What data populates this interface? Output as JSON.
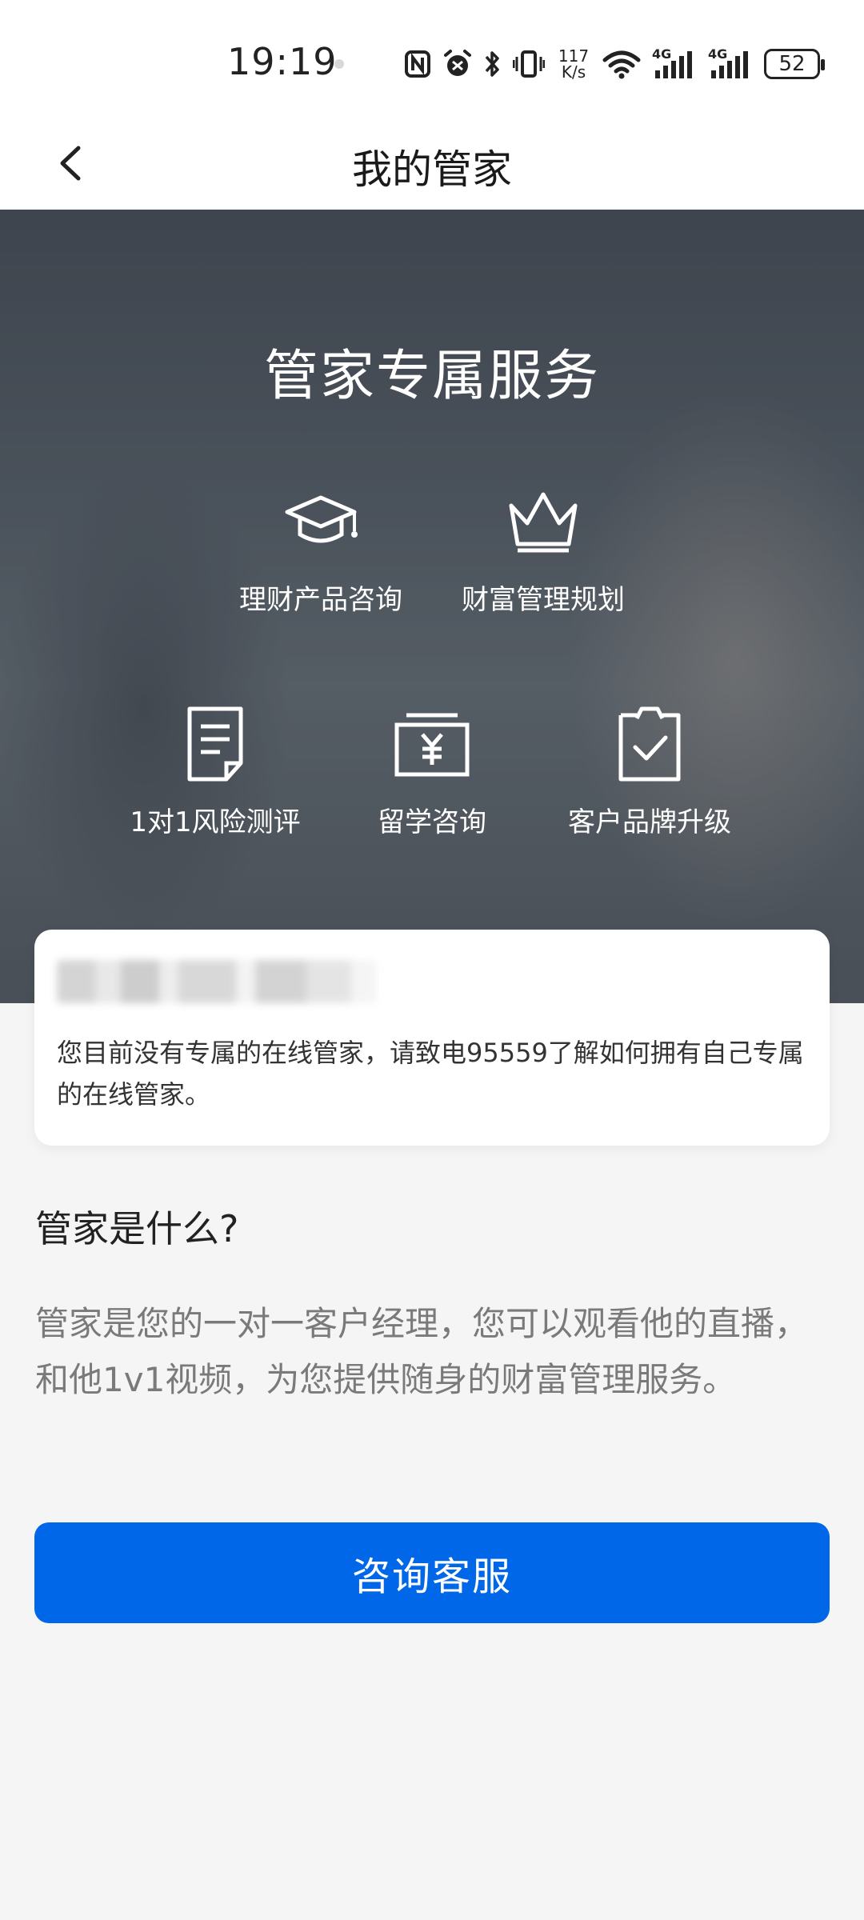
{
  "status_bar": {
    "time": "19:19",
    "speed_top": "117",
    "speed_bottom": "K/s",
    "net1": "4G",
    "net2": "4G",
    "battery": "52",
    "icons": [
      "nfc-icon",
      "alarm-icon",
      "bluetooth-icon",
      "vibrate-icon",
      "wifi-icon",
      "signal-icon",
      "signal-icon",
      "battery-icon"
    ]
  },
  "nav": {
    "title": "我的管家",
    "back_icon": "chevron-left-icon"
  },
  "hero": {
    "title": "管家专属服务",
    "features": [
      {
        "label": "理财产品咨询",
        "icon": "graduation-cap-icon"
      },
      {
        "label": "财富管理规划",
        "icon": "crown-icon"
      },
      {
        "label": "1对1风险测评",
        "icon": "document-icon"
      },
      {
        "label": "留学咨询",
        "icon": "yuan-card-icon"
      },
      {
        "label": "客户品牌升级",
        "icon": "clipboard-check-icon"
      }
    ]
  },
  "notice": {
    "text": "您目前没有专属的在线管家，请致电95559了解如何拥有自己专属的在线管家。"
  },
  "info": {
    "title": "管家是什么?",
    "body": "管家是您的一对一客户经理，您可以观看他的直播，和他1v1视频，为您提供随身的财富管理服务。"
  },
  "button": {
    "label": "咨询客服"
  },
  "colors": {
    "primary": "#0068e8",
    "background": "#f5f5f6"
  }
}
